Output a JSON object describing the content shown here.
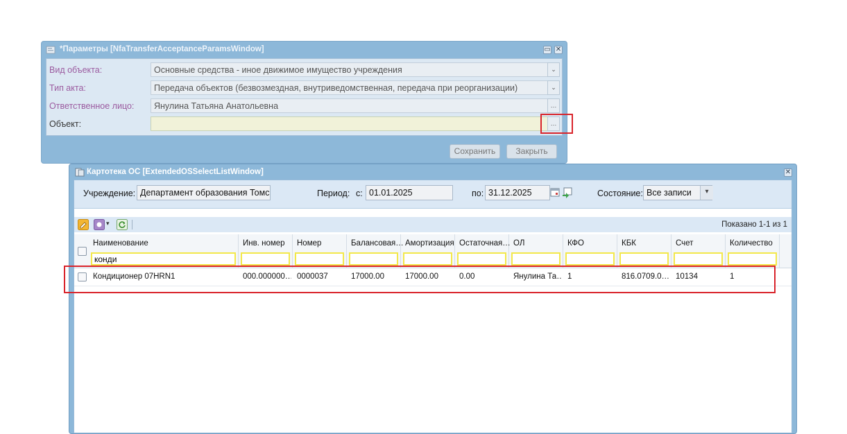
{
  "params_window": {
    "title": "*Параметры [NfaTransferAcceptanceParamsWindow]",
    "fields": {
      "object_type_label": "Вид объекта:",
      "object_type_value": "Основные средства - иное движимое имущество учреждения",
      "act_type_label": "Тип акта:",
      "act_type_value": "Передача объектов (безвозмездная, внутриведомственная, передача при реорганизации)",
      "responsible_label": "Ответственное лицо:",
      "responsible_value": "Янулина  Татьяна Анатольевна",
      "object_label": "Объект:",
      "object_value": ""
    },
    "ellipsis": "…",
    "save_label": "Сохранить",
    "close_label": "Закрыть"
  },
  "list_window": {
    "title": "Картотека ОС [ExtendedOSSelectListWindow]",
    "filters": {
      "institution_label": "Учреждение:",
      "institution_value": "Департамент образования Томск",
      "period_label": "Период:",
      "from_label": "с:",
      "from_value": "01.01.2025",
      "to_label": "по:",
      "to_value": "31.12.2025",
      "state_label": "Состояние:",
      "state_value": "Все записи"
    },
    "shown_text": "Показано 1-1 из 1",
    "columns": [
      "Наименование",
      "Инв. номер",
      "Номер",
      "Балансовая…",
      "Амортизация",
      "Остаточная…",
      "ОЛ",
      "КФО",
      "КБК",
      "Счет",
      "Количество"
    ],
    "name_filter_value": "конди",
    "rows": [
      {
        "name": "Кондиционер 07HRN1",
        "inv": "000.000000…",
        "number": "0000037",
        "balance": "17000.00",
        "amort": "17000.00",
        "residual": "0.00",
        "ol": "Янулина Та…",
        "kfo": "1",
        "kbk": "816.0709.0…",
        "account": "10134",
        "qty": "1"
      }
    ]
  },
  "colors": {
    "window_frame": "#8db8d9",
    "highlight_red": "#d9232a",
    "filter_border": "#f3e84a",
    "label_purple": "#9b5a9f"
  }
}
